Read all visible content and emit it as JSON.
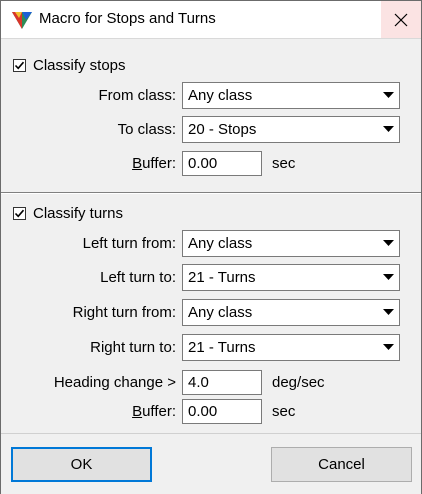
{
  "window": {
    "title": "Macro for Stops and Turns"
  },
  "stops": {
    "checkbox_label": "Classify stops",
    "checked": true,
    "from_class_label": "From class:",
    "from_class_value": "Any class",
    "to_class_label": "To class:",
    "to_class_value": "20 - Stops",
    "buffer_label": "Buffer:",
    "buffer_value": "0.00",
    "buffer_unit": "sec"
  },
  "turns": {
    "checkbox_label": "Classify turns",
    "checked": true,
    "left_from_label": "Left turn from:",
    "left_from_value": "Any class",
    "left_to_label": "Left turn to:",
    "left_to_value": "21 - Turns",
    "right_from_label": "Right turn from:",
    "right_from_value": "Any class",
    "right_to_label": "Right turn to:",
    "right_to_value": "21 - Turns",
    "heading_label": "Heading change >",
    "heading_value": "4.0",
    "heading_unit": "deg/sec",
    "buffer_label": "Buffer:",
    "buffer_value": "0.00",
    "buffer_unit": "sec"
  },
  "buttons": {
    "ok": "OK",
    "cancel": "Cancel"
  },
  "colors": {
    "focus_border": "#0078d7",
    "close_hover": "#fbe3e3"
  }
}
